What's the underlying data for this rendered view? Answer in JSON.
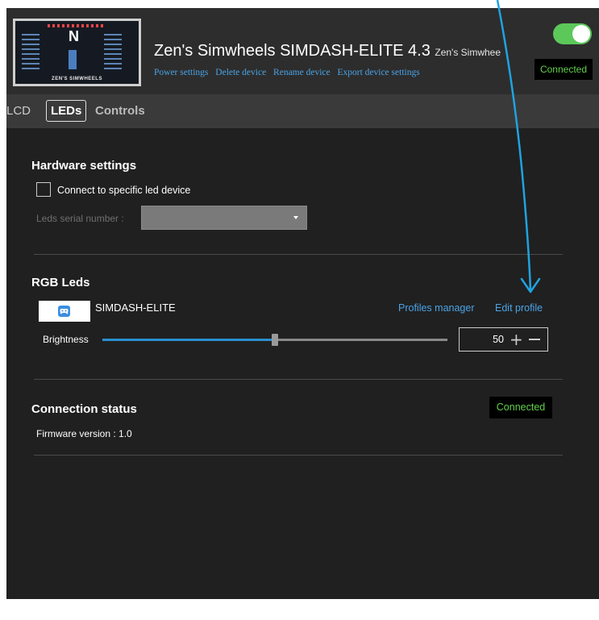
{
  "header": {
    "device_name": "Zen's Simwheels SIMDASH-ELITE 4.3",
    "device_subtitle": "Zen's Simwhee",
    "thumbnail_brand": "ZEN'S SIMWHEELS",
    "thumbnail_gear": "N",
    "links": [
      "Power settings",
      "Delete device",
      "Rename device",
      "Export device settings"
    ],
    "toggle_on": true,
    "status": "Connected"
  },
  "tabs": [
    {
      "label": "LCD",
      "active": false
    },
    {
      "label": "LEDs",
      "active": true
    },
    {
      "label": "Controls",
      "active": false
    }
  ],
  "hardware": {
    "title": "Hardware settings",
    "checkbox_label": "Connect to specific led device",
    "checkbox_checked": false,
    "serial_label": "Leds serial number :",
    "serial_value": ""
  },
  "rgb": {
    "title": "RGB Leds",
    "profile_icon": "gamepad-icon",
    "profile_name": "SIMDASH-ELITE",
    "profiles_manager": "Profiles manager",
    "edit_profile": "Edit profile",
    "brightness_label": "Brightness",
    "brightness_value": "50",
    "brightness_fraction": 0.5
  },
  "connection": {
    "title": "Connection status",
    "status": "Connected",
    "firmware": "Firmware version : 1.0"
  },
  "colors": {
    "accent": "#4aa3e6",
    "status_green": "#63d04b",
    "toggle_green": "#5cc85a",
    "annotation_arrow": "#1fa3e0"
  }
}
